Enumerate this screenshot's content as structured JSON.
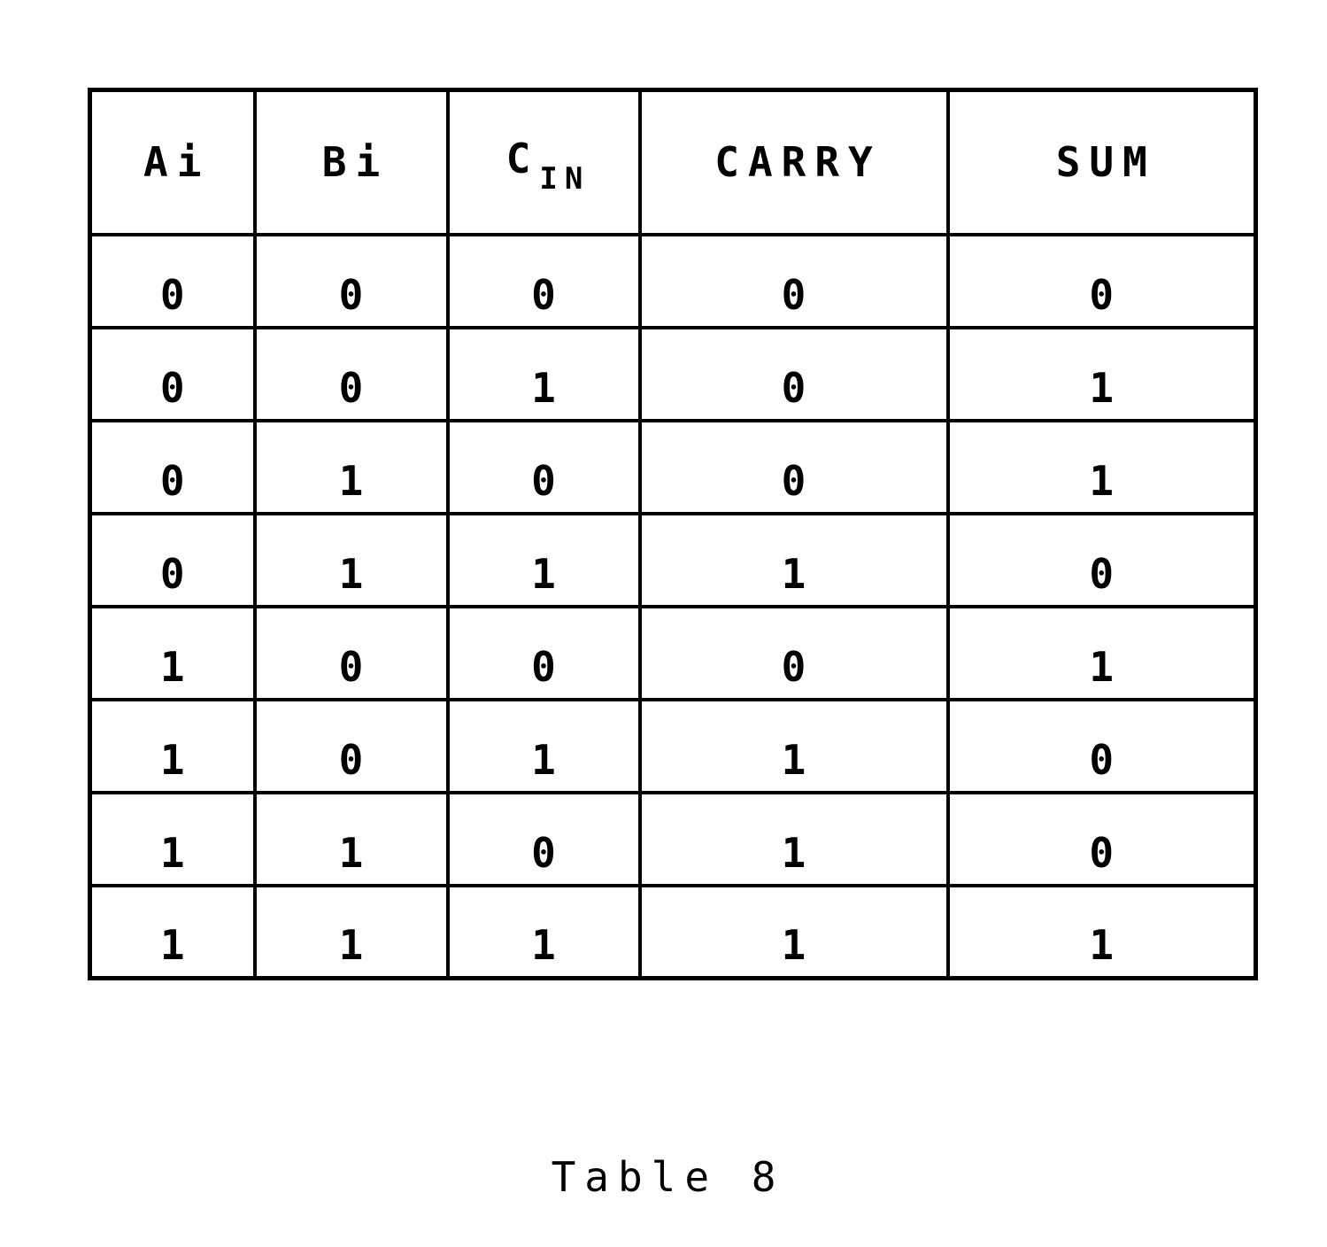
{
  "document": {
    "caption": "Table 8"
  },
  "table": {
    "columns": [
      {
        "key": "ai",
        "label": "Ai",
        "subscript": ""
      },
      {
        "key": "bi",
        "label": "Bi",
        "subscript": ""
      },
      {
        "key": "cin",
        "label": "C",
        "subscript": "IN"
      },
      {
        "key": "carry",
        "label": "CARRY",
        "subscript": ""
      },
      {
        "key": "sum",
        "label": "SUM",
        "subscript": ""
      }
    ],
    "rows": [
      {
        "ai": "0",
        "bi": "0",
        "cin": "0",
        "carry": "0",
        "sum": "0"
      },
      {
        "ai": "0",
        "bi": "0",
        "cin": "1",
        "carry": "0",
        "sum": "1"
      },
      {
        "ai": "0",
        "bi": "1",
        "cin": "0",
        "carry": "0",
        "sum": "1"
      },
      {
        "ai": "0",
        "bi": "1",
        "cin": "1",
        "carry": "1",
        "sum": "0"
      },
      {
        "ai": "1",
        "bi": "0",
        "cin": "0",
        "carry": "0",
        "sum": "1"
      },
      {
        "ai": "1",
        "bi": "0",
        "cin": "1",
        "carry": "1",
        "sum": "0"
      },
      {
        "ai": "1",
        "bi": "1",
        "cin": "0",
        "carry": "1",
        "sum": "0"
      },
      {
        "ai": "1",
        "bi": "1",
        "cin": "1",
        "carry": "1",
        "sum": "1"
      }
    ]
  },
  "chart_data": {
    "type": "table",
    "title": "Table 8",
    "columns": [
      "Ai",
      "Bi",
      "CIN",
      "CARRY",
      "SUM"
    ],
    "rows": [
      [
        "0",
        "0",
        "0",
        "0",
        "0"
      ],
      [
        "0",
        "0",
        "1",
        "0",
        "1"
      ],
      [
        "0",
        "1",
        "0",
        "0",
        "1"
      ],
      [
        "0",
        "1",
        "1",
        "1",
        "0"
      ],
      [
        "1",
        "0",
        "0",
        "0",
        "1"
      ],
      [
        "1",
        "0",
        "1",
        "1",
        "0"
      ],
      [
        "1",
        "1",
        "0",
        "1",
        "0"
      ],
      [
        "1",
        "1",
        "1",
        "1",
        "1"
      ]
    ]
  },
  "style": {
    "ink": "#000000",
    "paper": "#ffffff"
  }
}
